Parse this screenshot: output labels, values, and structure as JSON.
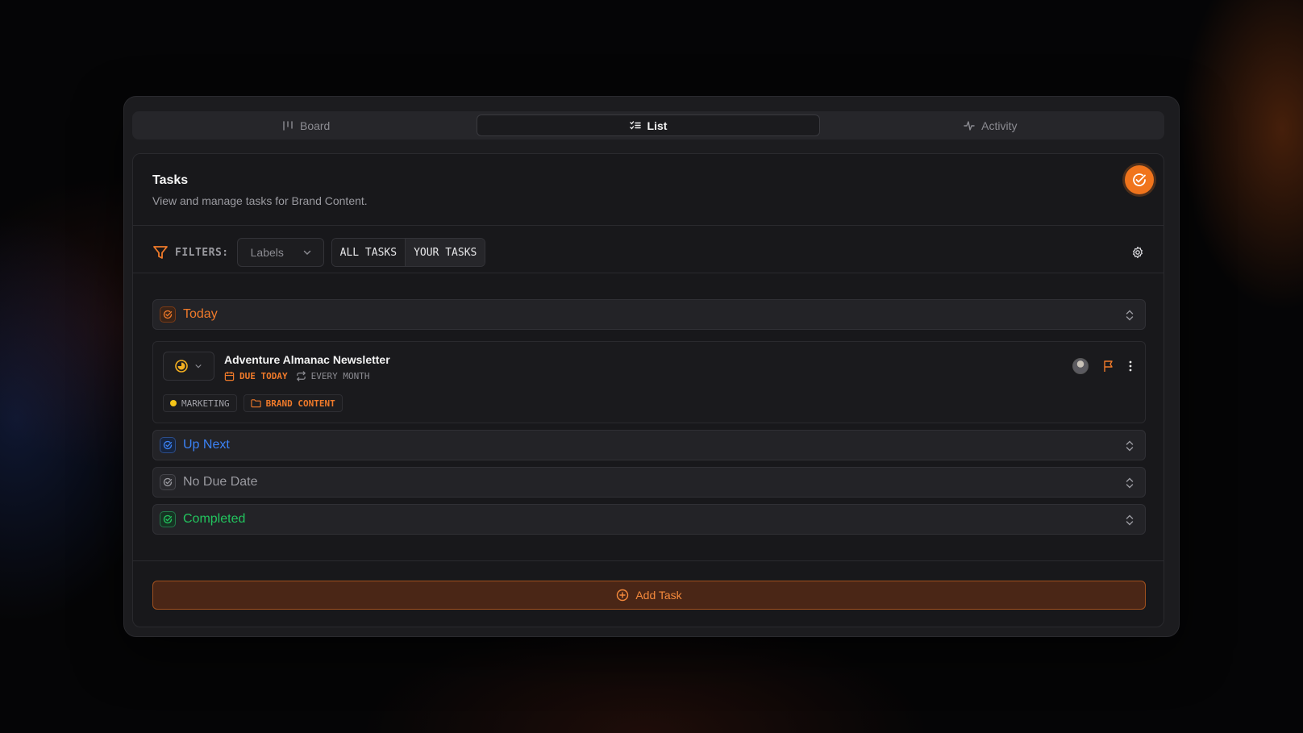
{
  "tabs": [
    {
      "label": "Board",
      "icon": "board-icon",
      "active": false
    },
    {
      "label": "List",
      "icon": "list-icon",
      "active": true
    },
    {
      "label": "Activity",
      "icon": "activity-icon",
      "active": false
    }
  ],
  "card": {
    "title": "Tasks",
    "subtitle": "View and manage tasks for Brand Content.",
    "badge_icon": "check-circle-icon"
  },
  "filters": {
    "label": "FILTERS:",
    "labels_select": "Labels",
    "scope_options": [
      "ALL TASKS",
      "YOUR TASKS"
    ],
    "settings_icon": "gear-icon"
  },
  "sections": {
    "today": {
      "label": "Today",
      "color": "#f07a2a"
    },
    "up_next": {
      "label": "Up Next",
      "color": "#3b82f6"
    },
    "no_due": {
      "label": "No Due Date",
      "color": "#9a9aa0"
    },
    "completed": {
      "label": "Completed",
      "color": "#22c55e"
    }
  },
  "task": {
    "title": "Adventure Almanac Newsletter",
    "due": "DUE TODAY",
    "recurrence": "EVERY MONTH",
    "tags": [
      {
        "label": "MARKETING",
        "color": "#f5c518"
      },
      {
        "label": "BRAND CONTENT",
        "color": "#f07a2a"
      }
    ]
  },
  "add_task": {
    "label": "Add Task"
  },
  "colors": {
    "accent": "#f07a2a",
    "background": "#18181b"
  }
}
